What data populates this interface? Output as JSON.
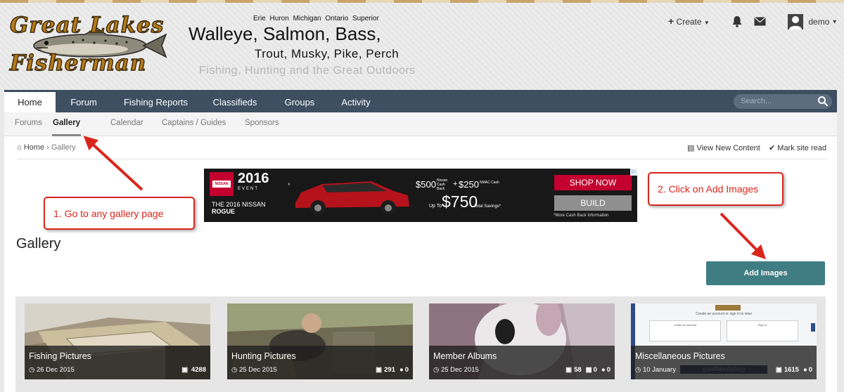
{
  "site": {
    "lakes": "Erie  Huron  Michigan  Ontario  Superior",
    "headline1": "Walleye, Salmon, Bass,",
    "headline2": "Trout, Musky, Pike, Perch",
    "tagline": "Fishing, Hunting and the Great Outdoors",
    "logo_line1": "Great Lakes",
    "logo_line2": "Fisherman"
  },
  "user_bar": {
    "create_label": "Create",
    "username": "demo"
  },
  "nav": {
    "items": [
      {
        "label": "Home",
        "active": true
      },
      {
        "label": "Forum",
        "active": false
      },
      {
        "label": "Fishing Reports",
        "active": false
      },
      {
        "label": "Classifieds",
        "active": false
      },
      {
        "label": "Groups",
        "active": false
      },
      {
        "label": "Activity",
        "active": false
      }
    ],
    "search_placeholder": "Search..."
  },
  "subnav": {
    "items": [
      {
        "label": "Forums",
        "active": false
      },
      {
        "label": "Gallery",
        "active": true
      },
      {
        "label": "Calendar",
        "active": false
      },
      {
        "label": "Captains / Guides",
        "active": false
      },
      {
        "label": "Sponsors",
        "active": false
      }
    ]
  },
  "breadcrumb": {
    "home": "Home",
    "current": "Gallery",
    "view_new": "View New Content",
    "mark_read": "Mark site read"
  },
  "ad": {
    "brand": "NISSAN",
    "year": "2016",
    "event": "EVENT",
    "line1": "THE 2016 NISSAN",
    "line2": "ROGUE",
    "offer_500": "$500",
    "offer_500_note": "Nissan Cash Back",
    "plus": "+",
    "offer_250": "$250",
    "offer_250_note": "NMAC Cash",
    "upto": "Up To",
    "offer_750": "$750",
    "offer_750_note": "Total Savings*",
    "shop": "SHOP NOW",
    "build": "BUILD",
    "fine": "*More Cash Back Information"
  },
  "page": {
    "title": "Gallery",
    "add_images": "Add Images"
  },
  "categories": [
    {
      "title": "Fishing Pictures",
      "date": "26 Dec 2015",
      "images": "4288",
      "albums": "",
      "comments": ""
    },
    {
      "title": "Hunting Pictures",
      "date": "25 Dec 2015",
      "images": "291",
      "albums": "",
      "comments": "0"
    },
    {
      "title": "Member Albums",
      "date": "25 Dec 2015",
      "images": "58",
      "albums": "0",
      "comments": "0"
    },
    {
      "title": "Miscellaneous Pictures",
      "date": "10 January",
      "images": "1615",
      "albums": "",
      "comments": "0"
    }
  ],
  "thumb4": {
    "heading": "Create an account or sign in to view",
    "left": "Create an account",
    "right": "Sign in",
    "brand": "greatlakesfishing"
  },
  "callouts": {
    "step1": "1. Go to any gallery page",
    "step2": "2.  Click on Add Images"
  },
  "colors": {
    "nav": "#3d4f61",
    "accent_button": "#3f7d82",
    "callout_red": "#d9261c",
    "logo_gold": "#b77a16"
  }
}
